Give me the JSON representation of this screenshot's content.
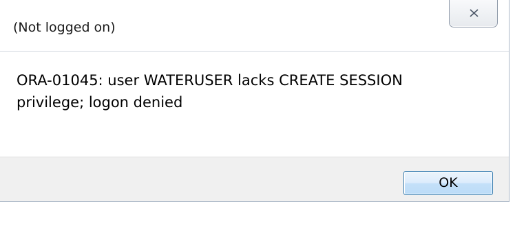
{
  "window": {
    "title": "(Not logged on)"
  },
  "message": {
    "line1": "ORA-01045: user WATERUSER lacks CREATE SESSION",
    "line2": "privilege; logon denied"
  },
  "buttons": {
    "ok_label": "OK",
    "close_icon": "close-x"
  }
}
